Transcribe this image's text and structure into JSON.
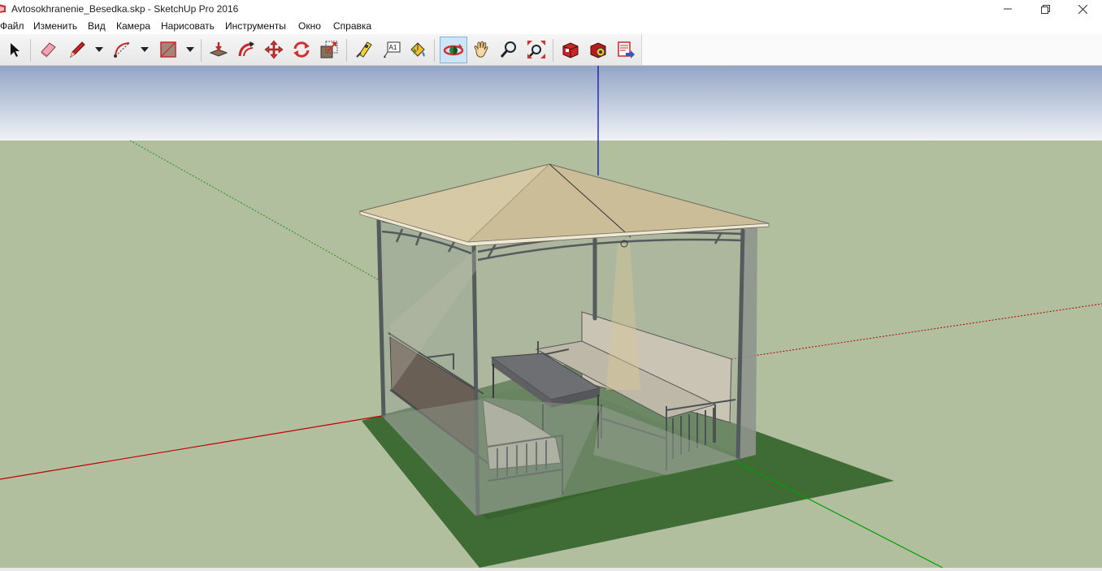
{
  "window": {
    "title": "Avtosokhranenie_Besedka.skp - SketchUp Pro 2016",
    "controls": [
      "minimize",
      "maximize",
      "close"
    ]
  },
  "menu": {
    "items": [
      "Файл",
      "Изменить",
      "Вид",
      "Камера",
      "Нарисовать",
      "Инструменты",
      "Окно",
      "Справка"
    ]
  },
  "toolbar": {
    "tools": [
      {
        "name": "select",
        "icon": "arrow-cursor-icon"
      },
      {
        "name": "eraser",
        "icon": "eraser-icon"
      },
      {
        "name": "line",
        "icon": "pencil-icon",
        "dropdown": true
      },
      {
        "name": "arc",
        "icon": "arc-icon",
        "dropdown": true
      },
      {
        "name": "rectangle",
        "icon": "rectangle-icon",
        "dropdown": true
      },
      {
        "name": "push-pull",
        "icon": "push-pull-icon"
      },
      {
        "name": "offset",
        "icon": "offset-icon"
      },
      {
        "name": "move",
        "icon": "move-icon"
      },
      {
        "name": "rotate",
        "icon": "rotate-icon"
      },
      {
        "name": "scale",
        "icon": "scale-icon"
      },
      {
        "name": "tape-measure",
        "icon": "tape-measure-icon"
      },
      {
        "name": "text",
        "icon": "text-icon",
        "label": "A1"
      },
      {
        "name": "paint-bucket",
        "icon": "paint-bucket-icon"
      },
      {
        "name": "orbit",
        "icon": "orbit-icon",
        "active": true
      },
      {
        "name": "pan",
        "icon": "hand-icon"
      },
      {
        "name": "zoom",
        "icon": "magnifier-icon"
      },
      {
        "name": "zoom-extents",
        "icon": "zoom-extents-icon"
      },
      {
        "name": "warehouse",
        "icon": "warehouse-icon"
      },
      {
        "name": "extension-warehouse",
        "icon": "extension-warehouse-icon"
      },
      {
        "name": "layout",
        "icon": "send-to-layout-icon"
      }
    ]
  },
  "colors": {
    "sky_top": "#93a5c5",
    "sky_bottom": "#f0f2f6",
    "ground": "#b2bf9f",
    "lawn": "#3f6b35",
    "roof": "#d6c9a5",
    "frame": "#555a5c",
    "axis_red": "#c00000",
    "axis_green": "#00a000",
    "axis_blue": "#0000c0",
    "active_tool": "#cde6f7"
  }
}
